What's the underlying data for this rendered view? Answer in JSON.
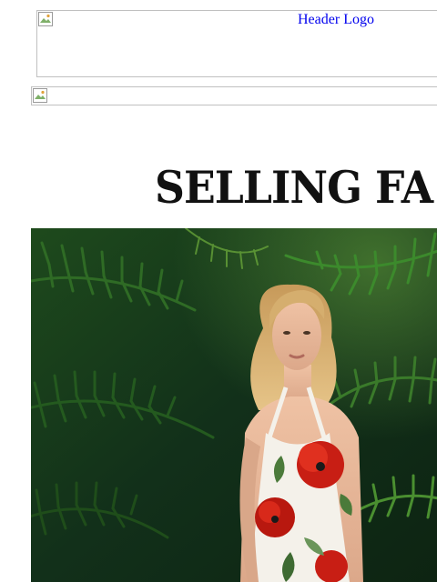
{
  "header": {
    "logo_alt": "Header Logo"
  },
  "banner": {
    "alt": ""
  },
  "headline": {
    "text": "SELLING FA"
  },
  "hero": {
    "palette": {
      "foliage_dark": "#10260f",
      "foliage_mid": "#2f6b25",
      "foliage_light": "#6fae3c",
      "dress": "#f4f1ea",
      "poppy_red": "#c81e14",
      "hair": "#d9b57a",
      "skin": "#e8b89a"
    }
  }
}
